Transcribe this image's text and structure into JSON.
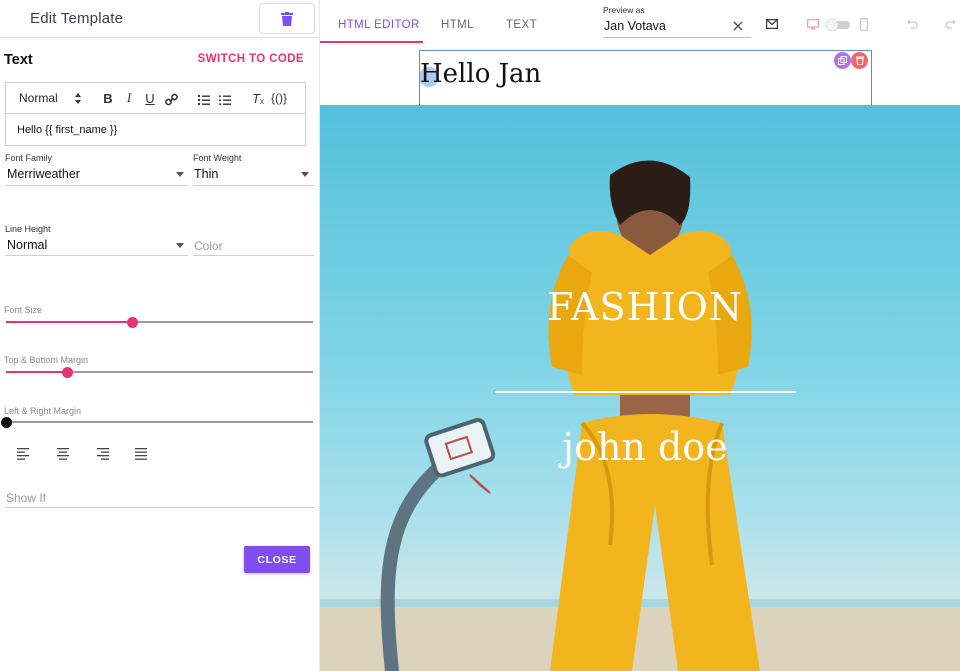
{
  "header": {
    "title": "Edit Template"
  },
  "text_section": {
    "title": "Text",
    "switch_label": "SWITCH TO CODE"
  },
  "editor": {
    "format_value": "Normal",
    "toolbar_icons": [
      "bold-icon",
      "italic-icon",
      "underline-icon",
      "link-icon",
      "ordered-list-icon",
      "bullet-list-icon",
      "clear-format-icon",
      "variable-icon"
    ],
    "variable_label": "{()}",
    "content": "Hello {{ first_name }}"
  },
  "fields": {
    "font_family": {
      "label": "Font Family",
      "value": "Merriweather"
    },
    "font_weight": {
      "label": "Font Weight",
      "value": "Thin"
    },
    "line_height": {
      "label": "Line Height",
      "value": "Normal"
    },
    "color": {
      "placeholder": "Color"
    }
  },
  "sliders": {
    "font_size": {
      "label": "Font Size",
      "fraction": 0.41
    },
    "top_bottom_margin": {
      "label": "Top & Bottom Margin",
      "fraction": 0.2
    },
    "left_right_margin": {
      "label": "Left & Right Margin",
      "fraction": 0.0
    }
  },
  "alignment_icons": [
    "align-left-icon",
    "align-center-icon",
    "align-right-icon",
    "align-justify-icon"
  ],
  "show_if": {
    "placeholder": "Show If"
  },
  "close_label": "CLOSE",
  "tabs": [
    {
      "label": "HTML EDITOR",
      "active": true
    },
    {
      "label": "HTML",
      "active": false
    },
    {
      "label": "TEXT",
      "active": false
    }
  ],
  "preview": {
    "label": "Preview as",
    "value": "Jan Votava"
  },
  "canvas": {
    "hello_text": "Hello Jan",
    "hero_title": "FASHION",
    "hero_subtitle": "john doe"
  },
  "colors": {
    "accent_pink": "#e8336f",
    "accent_purple": "#7e4ef0",
    "selection_blue": "#5b8bd6"
  }
}
